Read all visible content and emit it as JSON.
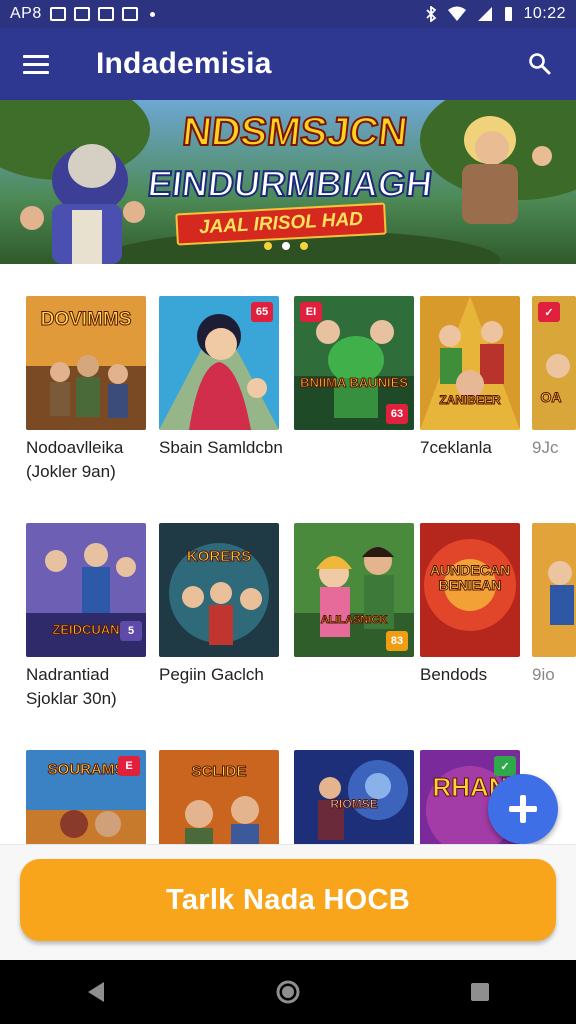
{
  "status_bar": {
    "left_text": "AP8",
    "time": "10:22",
    "icons": [
      "image-icon",
      "bag-icon",
      "document-icon",
      "picture-icon",
      "dot-icon",
      "bluetooth-icon",
      "wifi-icon",
      "signal-icon",
      "battery-icon"
    ]
  },
  "app_bar": {
    "title": "Indademisia",
    "menu_icon": "menu-icon",
    "search_icon": "search-icon",
    "background": "#2f3890"
  },
  "banner": {
    "line1": "NDSMSJCN",
    "line2": "EINDURMBIAGH",
    "ribbon": "JAAL IRISOL HAD",
    "page_count": 3,
    "active_page": 2
  },
  "grid": {
    "rows": [
      [
        {
          "thumb_text": "DOVIMMS",
          "caption_lines": [
            "Nodoavlleika",
            "(Jokler 9an)"
          ]
        },
        {
          "thumb_text": "",
          "caption_lines": [
            "Sbain Samldcbn"
          ]
        },
        {
          "thumb_text": "BNIIMA BAUNIES",
          "caption_lines": []
        },
        {
          "thumb_text": "ZANIBEER",
          "caption_lines": [
            "7ceklanla"
          ]
        },
        {
          "thumb_text": "OA",
          "caption_lines": [
            "9Jc"
          ]
        }
      ],
      [
        {
          "thumb_text": "ZEIDCUAN",
          "caption_lines": [
            "Nadrantiad",
            "Sjoklar 30n)"
          ]
        },
        {
          "thumb_text": "KORERS",
          "caption_lines": [
            "Pegiin Gaclch"
          ]
        },
        {
          "thumb_text": "ALILASNICK",
          "caption_lines": []
        },
        {
          "thumb_text": "AUNDECAN BENIEAN",
          "caption_lines": [
            "Bendods"
          ]
        },
        {
          "thumb_text": "",
          "caption_lines": [
            "9io"
          ]
        }
      ],
      [
        {
          "thumb_text": "SOURAMS",
          "caption_lines": []
        },
        {
          "thumb_text": "SCLIDE",
          "caption_lines": []
        },
        {
          "thumb_text": "RIOMSE",
          "caption_lines": []
        },
        {
          "thumb_text": "RHAN",
          "caption_lines": []
        }
      ]
    ]
  },
  "fab": {
    "icon": "plus-icon",
    "color": "#3f6fe6"
  },
  "cta": {
    "label": "Tarlk Nada HOCB",
    "color": "#f8a51c"
  },
  "nav_bar": {
    "icons": [
      "back-icon",
      "home-icon",
      "recents-icon"
    ]
  }
}
